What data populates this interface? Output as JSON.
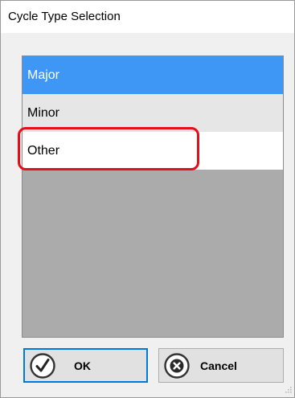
{
  "window": {
    "title": "Cycle Type Selection"
  },
  "list": {
    "items": [
      {
        "label": "Major",
        "state": "selected"
      },
      {
        "label": "Minor",
        "state": "normal"
      },
      {
        "label": "Other",
        "state": "highlighted"
      }
    ]
  },
  "buttons": {
    "ok": {
      "label": "OK",
      "icon": "check-circle-icon"
    },
    "cancel": {
      "label": "Cancel",
      "icon": "x-circle-icon"
    }
  },
  "colors": {
    "selection": "#3f97f5",
    "annotation": "#e3101b",
    "focus_border": "#0078d7",
    "list_background": "#ababab"
  }
}
